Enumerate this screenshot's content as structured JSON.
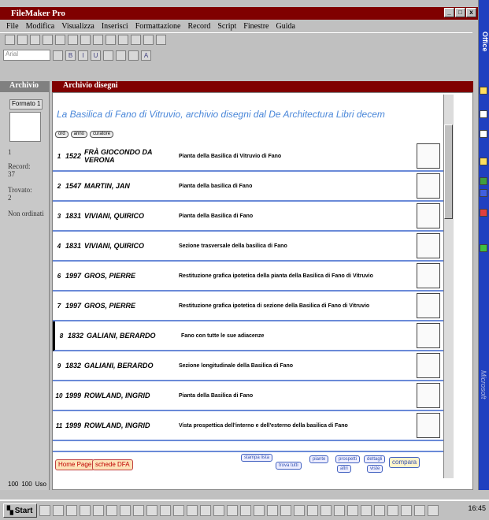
{
  "window": {
    "title": "FileMaker Pro"
  },
  "menu": [
    "File",
    "Modifica",
    "Visualizza",
    "Inserisci",
    "Formattazione",
    "Record",
    "Script",
    "Finestre",
    "Guida"
  ],
  "font_field": "Arial",
  "left_window": {
    "title": "Archivio",
    "layout_label": "Formato 1",
    "record_label": "Record:",
    "record_value": "37",
    "found_label": "Trovato:",
    "found_value": "2",
    "sort_label": "Non ordinati",
    "record_current": "1"
  },
  "doc_window": {
    "title": "Archivio disegni",
    "heading": "La Basilica di Fano di Vitruvio, archivio disegni dal De Architectura Libri decem",
    "header_buttons": [
      "ord",
      "anno",
      "curatore"
    ]
  },
  "rows": [
    {
      "n": "1",
      "year": "1522",
      "author": "FRÀ GIOCONDO DA VERONA",
      "title": "Pianta della Basilica di Vitruvio di Fano"
    },
    {
      "n": "2",
      "year": "1547",
      "author": "MARTIN, JAN",
      "title": "Pianta della basilica di Fano"
    },
    {
      "n": "3",
      "year": "1831",
      "author": "VIVIANI, QUIRICO",
      "title": "Pianta della Basilica di Fano"
    },
    {
      "n": "4",
      "year": "1831",
      "author": "VIVIANI, QUIRICO",
      "title": "Sezione trasversale della basilica di Fano"
    },
    {
      "n": "6",
      "year": "1997",
      "author": "GROS, PIERRE",
      "title": "Restituzione grafica ipotetica della pianta della Basilica di Fano di Vitruvio"
    },
    {
      "n": "7",
      "year": "1997",
      "author": "GROS, PIERRE",
      "title": "Restituzione grafica ipotetica di sezione della Basilica di Fano di Vitruvio"
    },
    {
      "n": "8",
      "year": "1832",
      "author": "GALIANI, BERARDO",
      "title": "Fano con tutte le sue adiacenze"
    },
    {
      "n": "9",
      "year": "1832",
      "author": "GALIANI, BERARDO",
      "title": "Sezione longitudinale della Basilica di Fano"
    },
    {
      "n": "10",
      "year": "1999",
      "author": "ROWLAND, INGRID",
      "title": "Pianta della Basilica di Fano"
    },
    {
      "n": "11",
      "year": "1999",
      "author": "ROWLAND, INGRID",
      "title": "Vista prospettica dell'interno e dell'esterno della basilica di Fano"
    }
  ],
  "footer": {
    "home": "Home Page",
    "schede": "schede DFA",
    "stampa": "stampa lista",
    "trova": "trova tutti",
    "piante": "piante",
    "prospetti": "prospetti",
    "dettagli": "dettagli",
    "altri": "altri",
    "viste": "viste",
    "compara": "compara"
  },
  "status_bar": {
    "zoom": "100",
    "zoom2": "100",
    "mode": "Uso"
  },
  "office_label": "Office",
  "ms_label": "Microsoft",
  "taskbar": {
    "start": "Start",
    "clock": "16:45"
  }
}
